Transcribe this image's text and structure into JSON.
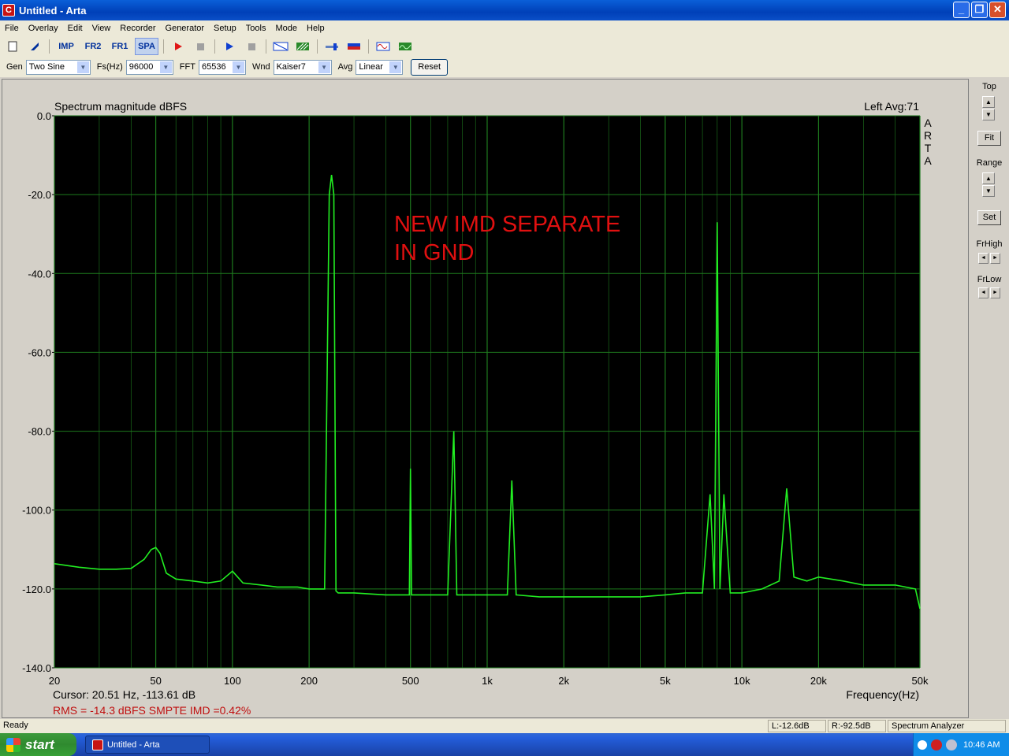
{
  "window": {
    "title": "Untitled - Arta",
    "app_icon_letter": "C",
    "minimize": "_",
    "maximize": "❐",
    "close": "✕"
  },
  "menu": [
    "File",
    "Overlay",
    "Edit",
    "View",
    "Recorder",
    "Generator",
    "Setup",
    "Tools",
    "Mode",
    "Help"
  ],
  "toolbar": {
    "imp": "IMP",
    "fr2": "FR2",
    "fr1": "FR1",
    "spa": "SPA"
  },
  "controls": {
    "gen_label": "Gen",
    "gen_value": "Two Sine",
    "fs_label": "Fs(Hz)",
    "fs_value": "96000",
    "fft_label": "FFT",
    "fft_value": "65536",
    "wnd_label": "Wnd",
    "wnd_value": "Kaiser7",
    "avg_label": "Avg",
    "avg_value": "Linear",
    "reset_label": "Reset"
  },
  "right_panel": {
    "top_label": "Top",
    "fit_label": "Fit",
    "range_label": "Range",
    "set_label": "Set",
    "frhigh_label": "FrHigh",
    "frlow_label": "FrLow"
  },
  "plot": {
    "title": "Spectrum magnitude dBFS",
    "channel_info": "Left  Avg:71",
    "watermark": [
      "A",
      "R",
      "T",
      "A"
    ],
    "annotation_line1": "NEW IMD SEPARATE",
    "annotation_line2": "IN GND",
    "xlabel": "Frequency(Hz)",
    "cursor_text": "Cursor: 20.51 Hz, -113.61 dB",
    "rms_text": "RMS =  -14.3 dBFS   SMPTE IMD =0.42%",
    "y_ticks": [
      "0.0",
      "-20.0",
      "-40.0",
      "-60.0",
      "-80.0",
      "-100.0",
      "-120.0",
      "-140.0"
    ],
    "x_ticks": [
      "20",
      "50",
      "100",
      "200",
      "500",
      "1k",
      "2k",
      "5k",
      "10k",
      "20k",
      "50k"
    ],
    "trace_color": "#22ee22",
    "grid_color": "#1e7a1e",
    "annotation_color": "#e01010"
  },
  "chart_data": {
    "type": "line",
    "title": "Spectrum magnitude dBFS",
    "xlabel": "Frequency(Hz)",
    "ylabel": "",
    "xscale": "log",
    "xlim": [
      20,
      50000
    ],
    "ylim": [
      -140,
      0
    ],
    "grid": true,
    "series": [
      {
        "x": [
          20,
          25,
          30,
          35,
          40,
          45,
          48,
          50,
          52,
          55,
          60,
          70,
          80,
          90,
          100,
          110,
          130,
          150,
          180,
          200,
          230,
          240,
          245,
          250,
          255,
          260,
          300,
          400,
          495,
          500,
          505,
          600,
          700,
          740,
          750,
          760,
          800,
          1000,
          1200,
          1250,
          1300,
          1600,
          2000,
          3000,
          4000,
          5000,
          6000,
          7000,
          7500,
          7800,
          8000,
          8200,
          8500,
          9000,
          10000,
          12000,
          14000,
          15000,
          16000,
          18000,
          20000,
          25000,
          30000,
          40000,
          48000,
          50000
        ],
        "y": [
          -113.6,
          -114.5,
          -115,
          -115,
          -114.8,
          -112.5,
          -110,
          -109.5,
          -111,
          -116,
          -117.5,
          -118,
          -118.5,
          -118,
          -115.5,
          -118.5,
          -119,
          -119.5,
          -119.5,
          -120,
          -120,
          -20,
          -15,
          -20,
          -120.5,
          -121,
          -121,
          -121.5,
          -121.5,
          -89.5,
          -121.5,
          -121.5,
          -121.5,
          -80,
          -100,
          -121.5,
          -121.5,
          -121.5,
          -121.5,
          -92.5,
          -121.5,
          -122,
          -122,
          -122,
          -122,
          -121.5,
          -121,
          -121,
          -96,
          -120,
          -27,
          -120,
          -96,
          -121,
          -121,
          -120,
          -118,
          -94.5,
          -117,
          -118,
          -117,
          -118,
          -119,
          -119,
          -120,
          -125
        ]
      }
    ]
  },
  "status": {
    "ready": "Ready",
    "left_level": "L:-12.6dB",
    "right_level": "R:-92.5dB",
    "mode": "Spectrum Analyzer"
  },
  "taskbar": {
    "start": "start",
    "task_title": "Untitled - Arta",
    "clock": "10:46 AM"
  }
}
